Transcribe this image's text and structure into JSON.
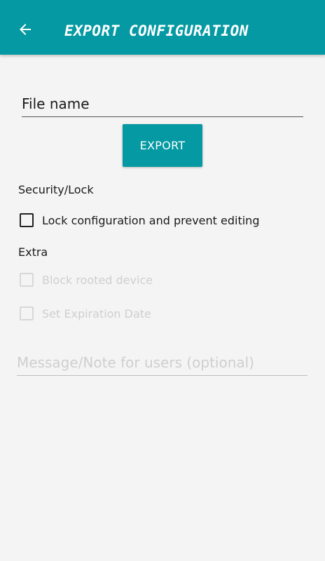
{
  "app_bar": {
    "title": "EXPORT CONFIGURATION",
    "back_icon": "arrow-left-icon",
    "background": "#0499a3"
  },
  "form": {
    "file_name_placeholder": "File name",
    "export_label": "EXPORT"
  },
  "security_section": {
    "title": "Security/Lock",
    "lock_label": "Lock configuration and prevent editing",
    "lock_checked": false
  },
  "extra_section": {
    "title": "Extra",
    "block_rooted_label": "Block rooted device",
    "block_rooted_enabled": false,
    "expiration_label": "Set Expiration Date",
    "expiration_enabled": false
  },
  "message": {
    "placeholder": "Message/Note for users (optional)"
  },
  "colors": {
    "accent": "#0499a3",
    "background": "#f4f4f4",
    "disabled_text": "#cfcfcf"
  }
}
